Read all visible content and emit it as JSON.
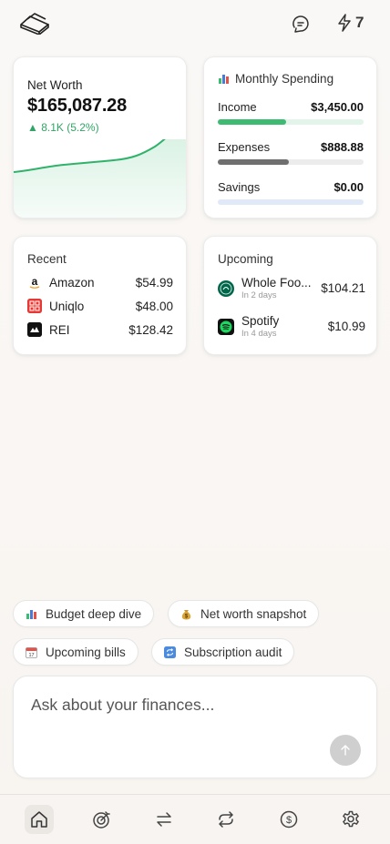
{
  "header": {
    "logo_icon": "stacked-bars-logo",
    "chat_icon": "chat-bubbles-icon",
    "bolt_icon": "lightning-bolt-icon",
    "bolt_count": "7"
  },
  "net_worth": {
    "label": "Net Worth",
    "value": "$165,087.28",
    "change": "▲ 8.1K (5.2%)",
    "change_color": "#31a565"
  },
  "monthly_spending": {
    "title": "Monthly Spending",
    "rows": [
      {
        "label": "Income",
        "amount": "$3,450.00",
        "fill_fraction": 0.47,
        "color": "#3dbb73",
        "track": "#e3f4ea"
      },
      {
        "label": "Expenses",
        "amount": "$888.88",
        "fill_fraction": 0.49,
        "color": "#6f6f6f",
        "track": "#ececec"
      },
      {
        "label": "Savings",
        "amount": "$0.00",
        "fill_fraction": 0.0,
        "color": "#9cc2ec",
        "track": "#dfe9f8"
      }
    ]
  },
  "recent": {
    "title": "Recent",
    "items": [
      {
        "name": "Amazon",
        "amount": "$54.99",
        "icon": "amazon-logo"
      },
      {
        "name": "Uniqlo",
        "amount": "$48.00",
        "icon": "uniqlo-logo"
      },
      {
        "name": "REI",
        "amount": "$128.42",
        "icon": "rei-logo"
      }
    ]
  },
  "upcoming": {
    "title": "Upcoming",
    "items": [
      {
        "name": "Whole Foo...",
        "when": "In 2 days",
        "amount": "$104.21",
        "icon": "whole-foods-logo"
      },
      {
        "name": "Spotify",
        "when": "In 4 days",
        "amount": "$10.99",
        "icon": "spotify-logo"
      }
    ]
  },
  "chips": [
    {
      "label": "Budget deep dive",
      "icon": "bar-chart-icon"
    },
    {
      "label": "Net worth snapshot",
      "icon": "money-bag-icon"
    },
    {
      "label": "Upcoming bills",
      "icon": "calendar-icon"
    },
    {
      "label": "Subscription audit",
      "icon": "repeat-icon"
    }
  ],
  "ask": {
    "placeholder": "Ask about your finances..."
  },
  "nav": [
    "home-icon",
    "goal-icon",
    "transfer-icon",
    "recurring-icon",
    "dollar-icon",
    "settings-icon"
  ]
}
